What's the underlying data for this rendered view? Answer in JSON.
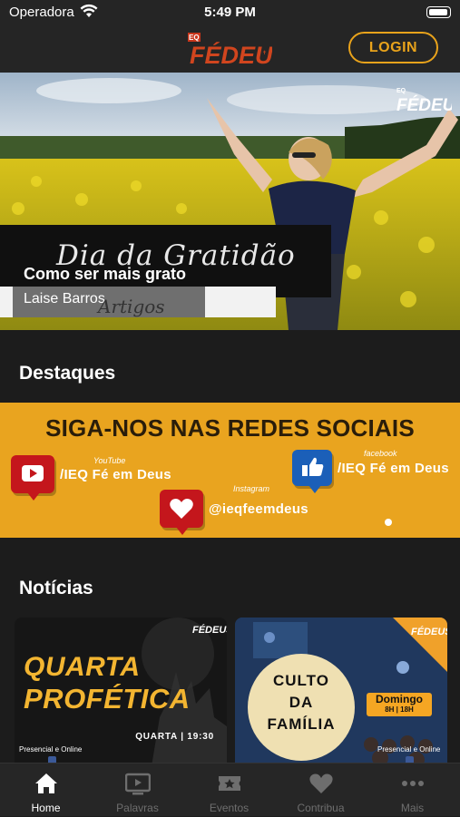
{
  "status_bar": {
    "carrier": "Operadora",
    "time": "5:49 PM"
  },
  "header": {
    "logo_text": "FÉDEUS",
    "login_label": "LOGIN"
  },
  "hero": {
    "script_title": "Dia da Gratidão",
    "headline": "Como ser mais grato",
    "author": "Laise Barros",
    "category": "Artigos",
    "corner_logo": "FÉDEUS"
  },
  "sections": {
    "highlights_title": "Destaques",
    "news_title": "Notícias"
  },
  "banner": {
    "title": "SIGA-NOS NAS REDES SOCIAIS",
    "youtube_small": "YouTube",
    "youtube_handle": "/IEQ Fé em Deus",
    "facebook_small": "facebook",
    "facebook_handle": "/IEQ Fé em Deus",
    "instagram_small": "Instagram",
    "instagram_handle": "@ieqfeemdeus",
    "colors": {
      "background": "#e9a41f",
      "youtube": "#c4161c",
      "facebook": "#1b5fb8",
      "instagram": "#c4161c"
    }
  },
  "news": [
    {
      "logo": "FÉDEUS",
      "line1": "QUARTA",
      "line2": "PROFÉTICA",
      "time": "QUARTA | 19:30",
      "sub": "Presencial e Online"
    },
    {
      "logo": "FÉDEUS",
      "title_lines": [
        "CULTO",
        "DA",
        "FAMÍLIA"
      ],
      "day": "Domingo",
      "hours": "8H | 18H",
      "sub": "Presencial e Online"
    }
  ],
  "tabs": [
    {
      "label": "Home",
      "icon": "home-icon",
      "active": true
    },
    {
      "label": "Palavras",
      "icon": "tv-play-icon",
      "active": false
    },
    {
      "label": "Eventos",
      "icon": "ticket-star-icon",
      "active": false
    },
    {
      "label": "Contribua",
      "icon": "heart-icon",
      "active": false
    },
    {
      "label": "Mais",
      "icon": "more-dots-icon",
      "active": false
    }
  ],
  "colors": {
    "accent": "#e9a31b",
    "background": "#1c1c1c",
    "bar": "#252525"
  }
}
